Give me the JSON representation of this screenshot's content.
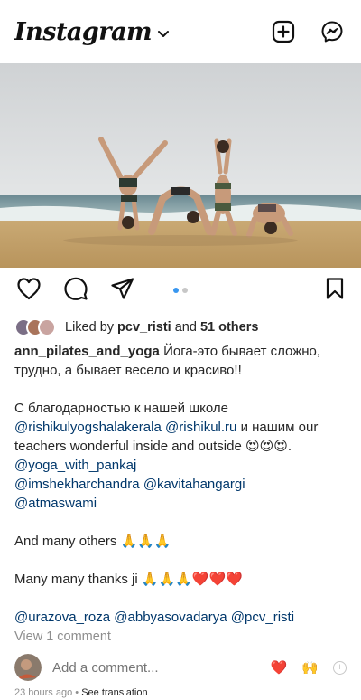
{
  "app": {
    "title": "Instagram"
  },
  "photo": {
    "alt": ""
  },
  "pager": {
    "count": 2,
    "active": 0
  },
  "likes": {
    "prefix": "Liked by",
    "user": "pcv_risti",
    "middle": "and",
    "others": "51 others"
  },
  "caption": {
    "username": "ann_pilates_and_yoga",
    "line1": "Йога-это бывает сложно,",
    "line2": "трудно, а бывает весело и красиво!!",
    "line3a": "С благодарностью к нашей школе",
    "m1": "@rishikulyogshalakerala",
    "m2": "@rishikul.ru",
    "line4b": "и нашим  our",
    "line5": "teachers wonderful inside and outside 😍😍😍.",
    "m3": "@yoga_with_pankaj",
    "m4": "@imshekharchandra",
    "m5": "@kavitahangargi",
    "m6": "@atmaswami",
    "line6": "And many others 🙏🙏🙏",
    "line7": "Many many thanks ji 🙏🙏🙏❤️❤️❤️",
    "m7": "@urazova_roza",
    "m8": "@abbyasovadarya",
    "m9": "@pcv_risti"
  },
  "comments": {
    "view_label": "View 1 comment"
  },
  "add_comment": {
    "placeholder": "Add a comment...",
    "quick1": "❤️",
    "quick2": "🙌",
    "quick3": "+"
  },
  "meta": {
    "time": "23 hours ago",
    "sep": " • ",
    "translate": "See translation"
  },
  "colors": {
    "link": "#00376b",
    "muted": "#8e8e8e",
    "accent": "#3897f0"
  }
}
